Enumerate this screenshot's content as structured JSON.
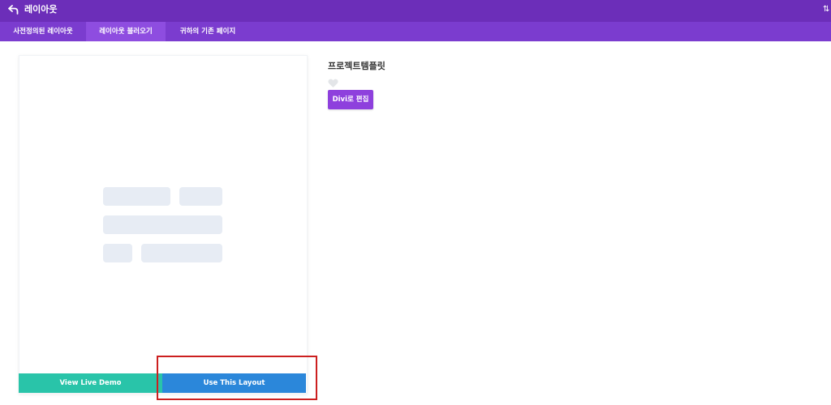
{
  "topbar": {
    "title": "레이아웃",
    "sort_glyph": "⇅"
  },
  "tabs": [
    {
      "label": "사전정의된 레이아웃",
      "active": false
    },
    {
      "label": "레이아웃 불러오기",
      "active": true
    },
    {
      "label": "귀하의 기존 페이지",
      "active": false
    }
  ],
  "preview": {
    "demo_button": "View Live Demo",
    "use_button": "Use This Layout"
  },
  "details": {
    "title": "프로젝트템플릿",
    "edit_button": "Divi로 편집"
  },
  "colors": {
    "topbar": "#6c2eb9",
    "tabbar": "#7b3ccf",
    "tab_active": "#8e4de0",
    "demo_button": "#29c4a9",
    "use_button": "#2b87da",
    "edit_button": "#8e40dd",
    "highlight": "#cc1f1f",
    "placeholder": "#e7ecf4"
  }
}
